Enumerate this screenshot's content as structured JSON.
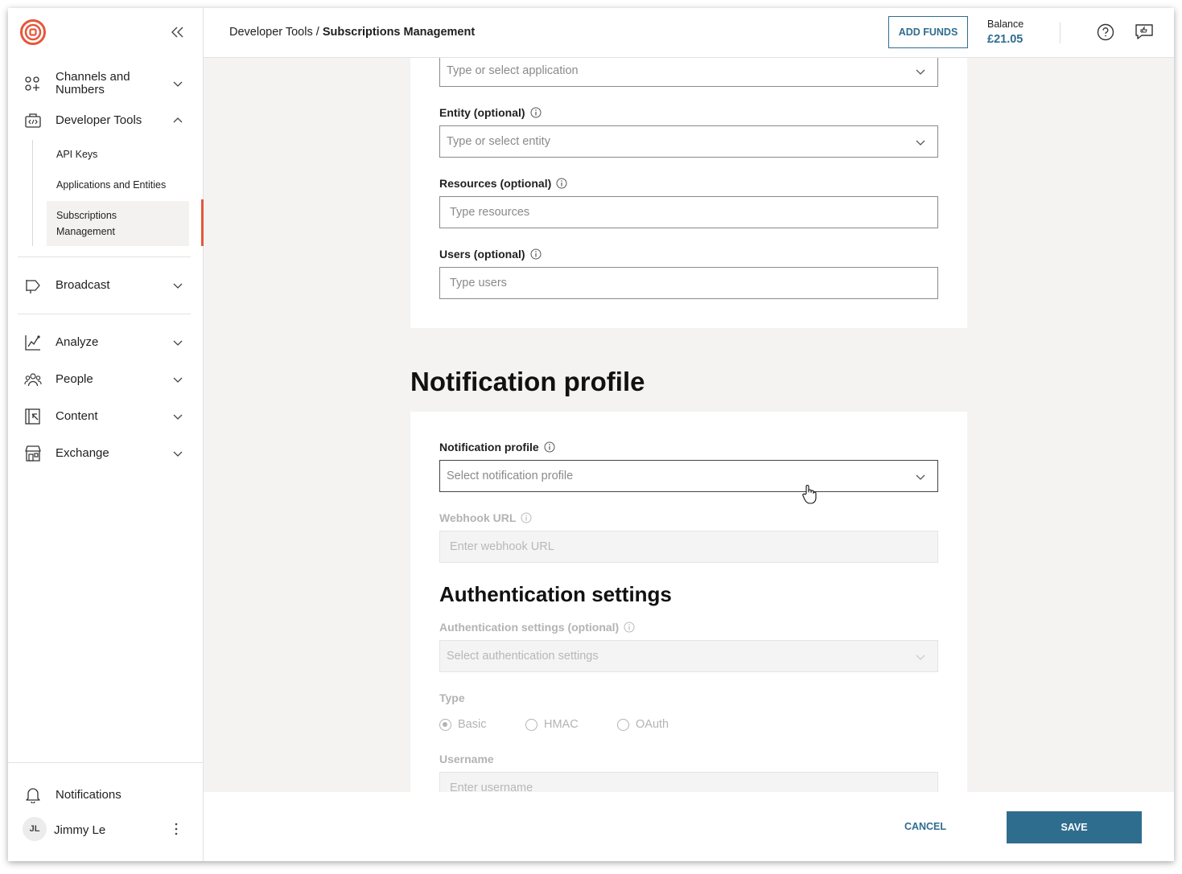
{
  "sidebar": {
    "items": [
      {
        "label": "Channels and Numbers",
        "icon": "channels-icon"
      },
      {
        "label": "Developer Tools",
        "icon": "developer-tools-icon"
      },
      {
        "label": "Broadcast",
        "icon": "broadcast-icon"
      },
      {
        "label": "Analyze",
        "icon": "analyze-icon"
      },
      {
        "label": "People",
        "icon": "people-icon"
      },
      {
        "label": "Content",
        "icon": "content-icon"
      },
      {
        "label": "Exchange",
        "icon": "exchange-icon"
      }
    ],
    "developer_tools_sub": [
      {
        "label": "API Keys"
      },
      {
        "label": "Applications and Entities"
      },
      {
        "label": "Subscriptions Management",
        "active": true
      }
    ],
    "notifications_label": "Notifications",
    "user": {
      "initials": "JL",
      "name": "Jimmy Le"
    }
  },
  "header": {
    "breadcrumb_parent": "Developer Tools /",
    "breadcrumb_current": "Subscriptions Management",
    "add_funds_label": "ADD FUNDS",
    "balance_label": "Balance",
    "balance_value": "£21.05"
  },
  "form": {
    "application_placeholder": "Type or select application",
    "entity_label": "Entity (optional)",
    "entity_placeholder": "Type or select entity",
    "resources_label": "Resources (optional)",
    "resources_placeholder": "Type resources",
    "users_label": "Users (optional)",
    "users_placeholder": "Type users",
    "notification_section_title": "Notification profile",
    "notification_profile_label": "Notification profile",
    "notification_profile_placeholder": "Select notification profile",
    "webhook_label": "Webhook URL",
    "webhook_placeholder": "Enter webhook URL",
    "auth_section_title": "Authentication settings",
    "auth_label": "Authentication settings (optional)",
    "auth_placeholder": "Select authentication settings",
    "type_label": "Type",
    "type_options": [
      "Basic",
      "HMAC",
      "OAuth"
    ],
    "type_selected": "Basic",
    "username_label": "Username",
    "username_placeholder": "Enter username"
  },
  "footer": {
    "cancel_label": "CANCEL",
    "save_label": "SAVE"
  },
  "colors": {
    "accent": "#2f6d8f",
    "brand": "#e4573b",
    "page_bg": "#f4f3f1"
  }
}
